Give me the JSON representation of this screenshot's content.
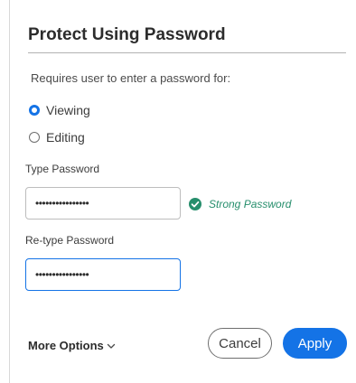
{
  "dialog": {
    "title": "Protect Using Password",
    "subtitle": "Requires user to enter a password for:",
    "options": [
      {
        "label": "Viewing",
        "checked": true
      },
      {
        "label": "Editing",
        "checked": false
      }
    ],
    "type_password": {
      "label": "Type Password",
      "value": "••••••••••••••••"
    },
    "retype_password": {
      "label": "Re-type Password",
      "value": "••••••••••••••••"
    },
    "strength": {
      "text": "Strong Password",
      "icon": "check-circle-icon",
      "color": "#268e6c"
    },
    "more_options": {
      "label": "More Options",
      "icon": "chevron-down-icon"
    },
    "buttons": {
      "cancel": "Cancel",
      "apply": "Apply"
    },
    "colors": {
      "accent": "#1473e6",
      "success": "#268e6c"
    }
  }
}
